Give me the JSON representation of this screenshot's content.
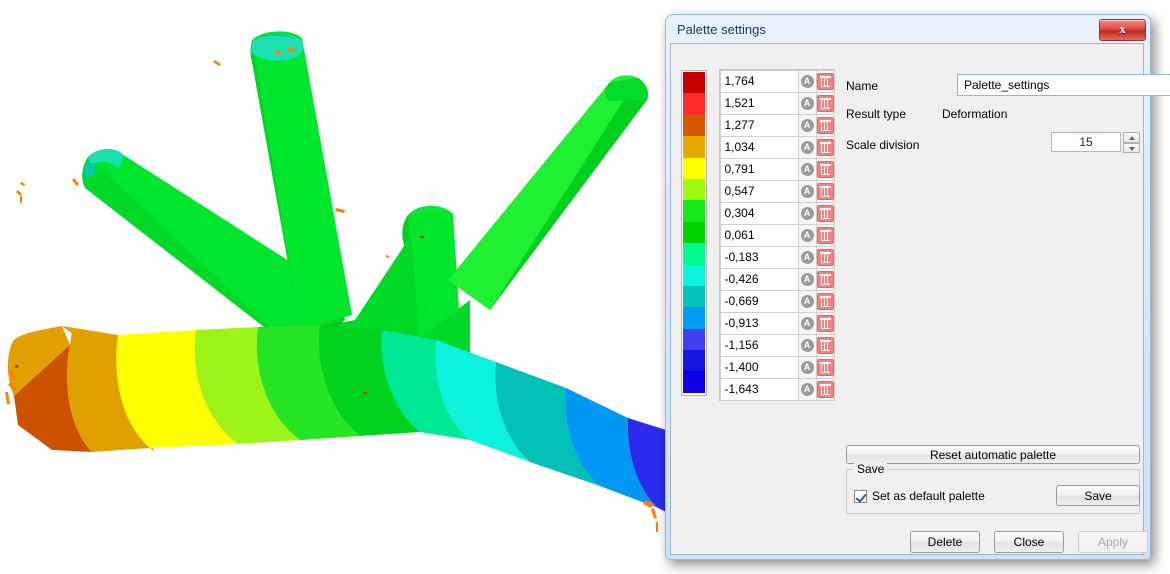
{
  "window": {
    "title": "Palette settings",
    "close_icon": "close-icon",
    "close_label": "x"
  },
  "palette": {
    "colors": [
      "#c40000",
      "#ff2b2b",
      "#d45a00",
      "#e8a800",
      "#ffff00",
      "#9dfa0d",
      "#17e817",
      "#00d400",
      "#00fa8c",
      "#0bf3e0",
      "#00c4bb",
      "#009bf5",
      "#4040f0",
      "#1616e0",
      "#1000e8"
    ],
    "rows": [
      {
        "value": "1,764",
        "auto_icon": "auto-circle-icon",
        "delete_icon": "trash-icon"
      },
      {
        "value": "1,521",
        "auto_icon": "auto-circle-icon",
        "delete_icon": "trash-icon"
      },
      {
        "value": "1,277",
        "auto_icon": "auto-circle-icon",
        "delete_icon": "trash-icon"
      },
      {
        "value": "1,034",
        "auto_icon": "auto-circle-icon",
        "delete_icon": "trash-icon"
      },
      {
        "value": "0,791",
        "auto_icon": "auto-circle-icon",
        "delete_icon": "trash-icon"
      },
      {
        "value": "0,547",
        "auto_icon": "auto-circle-icon",
        "delete_icon": "trash-icon"
      },
      {
        "value": "0,304",
        "auto_icon": "auto-circle-icon",
        "delete_icon": "trash-icon"
      },
      {
        "value": "0,061",
        "auto_icon": "auto-circle-icon",
        "delete_icon": "trash-icon"
      },
      {
        "value": "-0,183",
        "auto_icon": "auto-circle-icon",
        "delete_icon": "trash-icon"
      },
      {
        "value": "-0,426",
        "auto_icon": "auto-circle-icon",
        "delete_icon": "trash-icon"
      },
      {
        "value": "-0,669",
        "auto_icon": "auto-circle-icon",
        "delete_icon": "trash-icon"
      },
      {
        "value": "-0,913",
        "auto_icon": "auto-circle-icon",
        "delete_icon": "trash-icon"
      },
      {
        "value": "-1,156",
        "auto_icon": "auto-circle-icon",
        "delete_icon": "trash-icon"
      },
      {
        "value": "-1,400",
        "auto_icon": "auto-circle-icon",
        "delete_icon": "trash-icon"
      },
      {
        "value": "-1,643",
        "auto_icon": "auto-circle-icon",
        "delete_icon": "trash-icon"
      }
    ]
  },
  "fields": {
    "name_label": "Name",
    "name_value": "Palette_settings",
    "result_type_label": "Result type",
    "result_type_value": "Deformation",
    "scale_division_label": "Scale division",
    "scale_division_value": "15"
  },
  "actions": {
    "reset_label": "Reset automatic palette",
    "save_group_title": "Save",
    "set_default_label": "Set as default palette",
    "save_label": "Save",
    "delete_label": "Delete",
    "close_label": "Close",
    "apply_label": "Apply"
  },
  "viewport": {
    "model_name": "fea-deformation-contour-model",
    "background": "#ffffff"
  }
}
